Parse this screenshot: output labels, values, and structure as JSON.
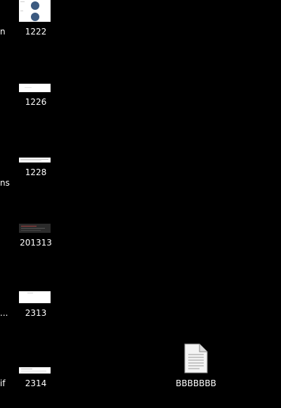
{
  "desktop": {
    "left_edge_labels": [
      "n",
      "ns",
      "...",
      "if"
    ],
    "icons": [
      {
        "label": "1222"
      },
      {
        "label": "1226"
      },
      {
        "label": "1228"
      },
      {
        "label": "201313"
      },
      {
        "label": "2313"
      },
      {
        "label": "2314"
      },
      {
        "label": "BBBBBBB",
        "icon": "text-file-icon"
      }
    ]
  }
}
